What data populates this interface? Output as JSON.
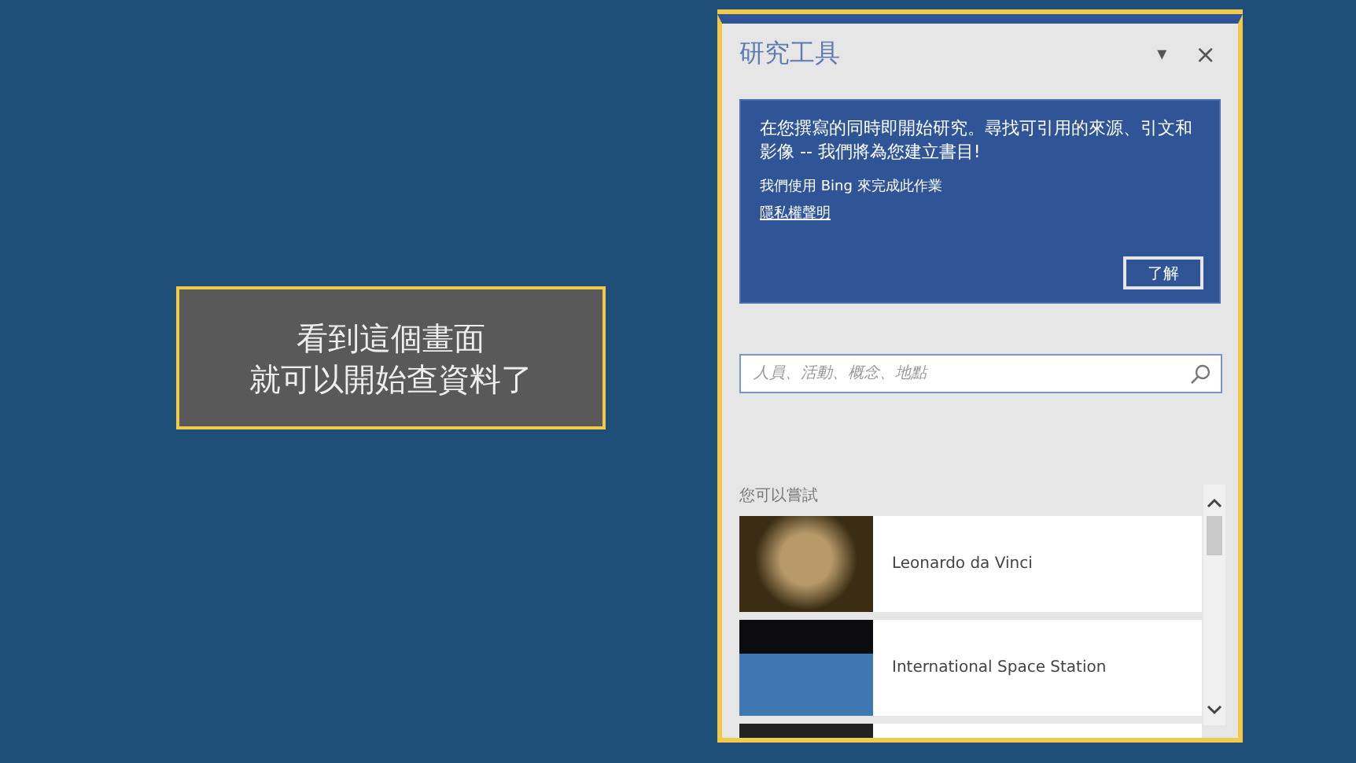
{
  "callout": {
    "lines": [
      "看到這個畫面",
      "就可以開始查資料了"
    ]
  },
  "pane": {
    "title": "研究工具",
    "menu_glyph": "▾",
    "close_glyph": "×"
  },
  "info": {
    "message": "在您撰寫的同時即開始研究。尋找可引用的來源、引文和影像 -- 我們將為您建立書目!",
    "note": "我們使用 Bing 來完成此作業",
    "link": "隱私權聲明",
    "button": "了解"
  },
  "search": {
    "placeholder": "人員、活動、概念、地點"
  },
  "suggestions": {
    "heading": "您可以嘗試",
    "items": [
      {
        "title": "Leonardo da Vinci",
        "kind": "portrait"
      },
      {
        "title": "International Space Station",
        "kind": "space"
      }
    ]
  }
}
